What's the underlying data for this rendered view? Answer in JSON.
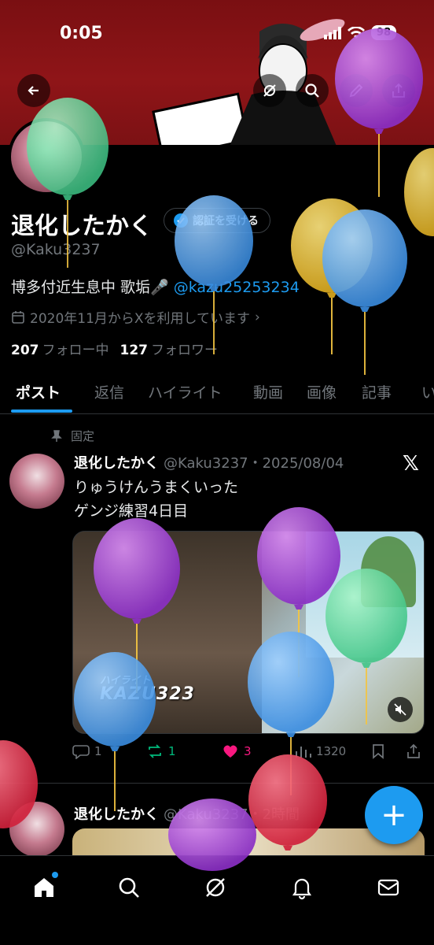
{
  "status": {
    "time": "0:05",
    "battery": "98"
  },
  "profile": {
    "display_name": "退化したかく",
    "verify_label": "認証を受ける",
    "handle": "@Kaku3237",
    "bio_text": "博多付近生息中 歌垢🎤 ",
    "bio_mention": "@kazu25253234",
    "joined": "2020年11月からXを利用しています",
    "following_count": "207",
    "following_label": "フォロー中",
    "followers_count": "127",
    "followers_label": "フォロワー"
  },
  "tabs": [
    "ポスト",
    "返信",
    "ハイライト",
    "動画",
    "画像",
    "記事",
    "い"
  ],
  "post1": {
    "pinned_label": "固定",
    "name": "退化したかく",
    "meta": "@Kaku3237・2025/08/04",
    "text_line1": "りゅうけんうまくいった",
    "text_line2": "ゲンジ練習4日目",
    "media_label_small": "ハイライト",
    "media_label_big": "KAZU323",
    "replies": "1",
    "reposts": "1",
    "likes": "3",
    "views": "1320"
  },
  "post2": {
    "name": "退化したかく",
    "meta": "@Kaku3237・2時間"
  },
  "fab_label": "+",
  "colors": {
    "accent": "#1d9bf0",
    "like": "#f91880",
    "repost": "#00ba7c",
    "banner": "#8f1518"
  },
  "icons": [
    "back-arrow-icon",
    "grok-icon",
    "search-icon",
    "edit-icon",
    "share-icon",
    "calendar-icon",
    "pin-icon",
    "x-logo-icon",
    "reply-icon",
    "repost-icon",
    "heart-icon",
    "views-icon",
    "bookmark-icon",
    "mute-icon",
    "home-icon",
    "explore-icon",
    "grok-nav-icon",
    "bell-icon",
    "mail-icon"
  ]
}
